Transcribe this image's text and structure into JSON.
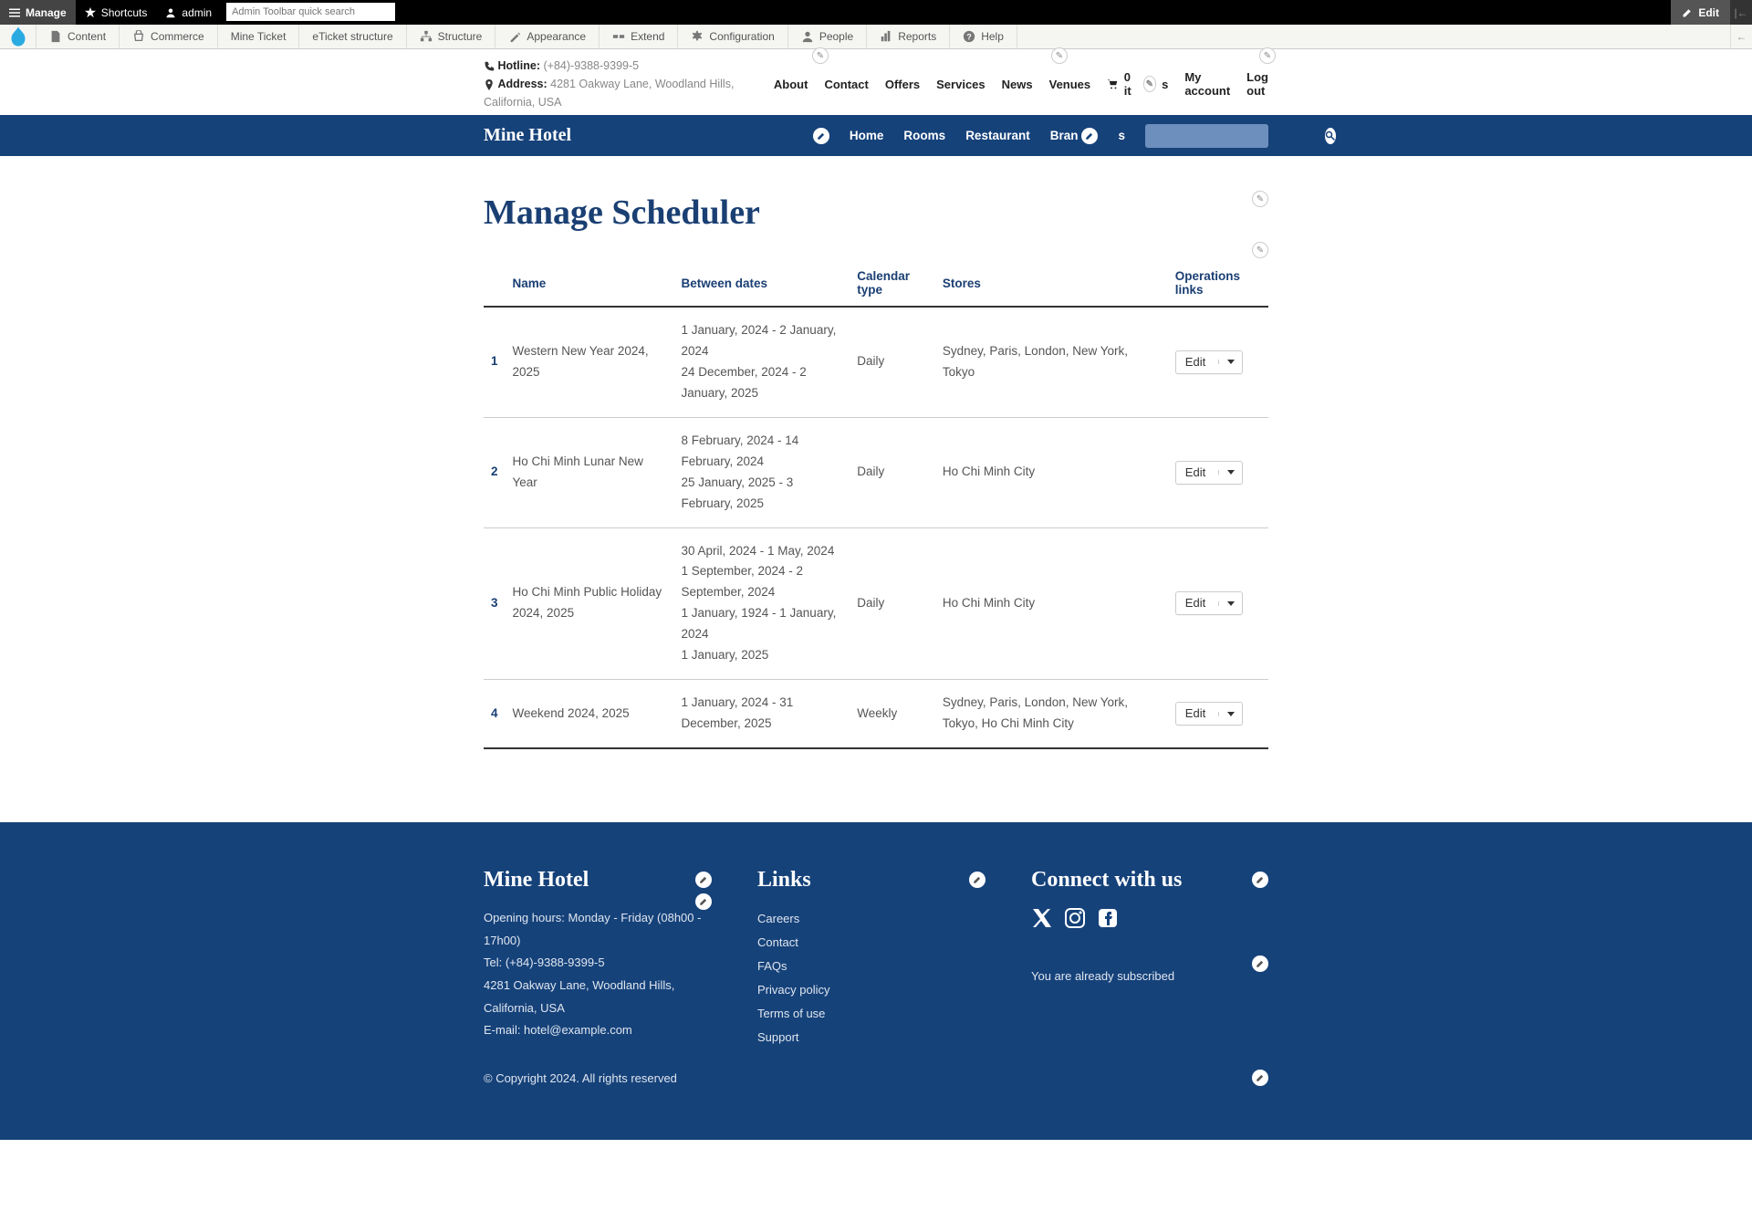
{
  "toolbar": {
    "manage": "Manage",
    "shortcuts": "Shortcuts",
    "user": "admin",
    "search_placeholder": "Admin Toolbar quick search",
    "edit": "Edit"
  },
  "admin_menu": {
    "items": [
      {
        "label": "Content"
      },
      {
        "label": "Commerce"
      },
      {
        "label": "Mine Ticket"
      },
      {
        "label": "eTicket structure"
      },
      {
        "label": "Structure"
      },
      {
        "label": "Appearance"
      },
      {
        "label": "Extend"
      },
      {
        "label": "Configuration"
      },
      {
        "label": "People"
      },
      {
        "label": "Reports"
      },
      {
        "label": "Help"
      }
    ]
  },
  "contact": {
    "hotline_label": "Hotline:",
    "hotline_value": "(+84)-9388-9399-5",
    "address_label": "Address:",
    "address_value": "4281 Oakway Lane, Woodland Hills, California, USA",
    "nav": [
      "About",
      "Contact",
      "Offers",
      "Services",
      "News",
      "Venues"
    ],
    "cart_count": "0 it",
    "cart_suffix": "s",
    "account": "My account",
    "logout": "Log out"
  },
  "bluenav": {
    "brand": "Mine Hotel",
    "links": [
      "Home",
      "Rooms",
      "Restaurant",
      "Bran",
      "s"
    ]
  },
  "page_title": "Manage Scheduler",
  "table": {
    "headers": [
      "",
      "Name",
      "Between dates",
      "Calendar type",
      "Stores",
      "Operations links"
    ],
    "op_label": "Edit",
    "rows": [
      {
        "idx": "1",
        "name": "Western New Year 2024, 2025",
        "dates": [
          "1 January, 2024 - 2 January, 2024",
          "24 December, 2024 - 2 January, 2025"
        ],
        "cal": "Daily",
        "stores": "Sydney, Paris, London, New York, Tokyo"
      },
      {
        "idx": "2",
        "name": "Ho Chi Minh Lunar New Year",
        "dates": [
          "8 February, 2024 - 14 February, 2024",
          "25 January, 2025 - 3 February, 2025"
        ],
        "cal": "Daily",
        "stores": "Ho Chi Minh City"
      },
      {
        "idx": "3",
        "name": "Ho Chi Minh Public Holiday 2024, 2025",
        "dates": [
          "30 April, 2024 - 1 May, 2024",
          "1 September, 2024 - 2 September, 2024",
          "1 January, 1924 - 1 January, 2024",
          "1 January, 2025"
        ],
        "cal": "Daily",
        "stores": "Ho Chi Minh City"
      },
      {
        "idx": "4",
        "name": "Weekend 2024, 2025",
        "dates": [
          "1 January, 2024 - 31 December, 2025"
        ],
        "cal": "Weekly",
        "stores": "Sydney, Paris, London, New York, Tokyo, Ho Chi Minh City"
      }
    ]
  },
  "footer": {
    "col1_title": "Mine Hotel",
    "opening": "Opening hours: Monday - Friday (08h00 - 17h00)",
    "tel": "Tel: (+84)-9388-9399-5",
    "addr": "4281 Oakway Lane, Woodland Hills, California, USA",
    "email": "E-mail: hotel@example.com",
    "links_title": "Links",
    "links": [
      "Careers",
      "Contact",
      "FAQs",
      "Privacy policy",
      "Terms of use",
      "Support"
    ],
    "connect_title": "Connect with us",
    "subscribed": "You are already subscribed",
    "copyright": "© Copyright 2024. All rights reserved"
  }
}
